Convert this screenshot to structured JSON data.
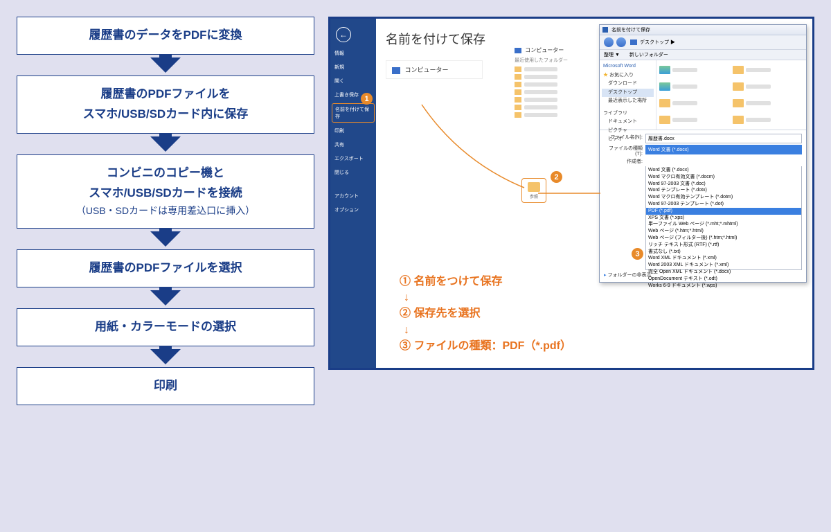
{
  "steps": [
    {
      "main": "履歴書のデータをPDFに変換",
      "sub": ""
    },
    {
      "main": "履歴書のPDFファイルを\nスマホ/USB/SDカード内に保存",
      "sub": ""
    },
    {
      "main": "コンビニのコピー機と\nスマホ/USB/SDカードを接続",
      "sub": "（USB・SDカードは専用差込口に挿入）"
    },
    {
      "main": "履歴書のPDFファイルを選択",
      "sub": ""
    },
    {
      "main": "用紙・カラーモードの選択",
      "sub": ""
    },
    {
      "main": "印刷",
      "sub": ""
    }
  ],
  "word": {
    "menu": [
      "情報",
      "新規",
      "開く",
      "上書き保存",
      "名前を付けて保存",
      "印刷",
      "共有",
      "エクスポート",
      "閉じる",
      "アカウント",
      "オプション"
    ],
    "hl_index": 4,
    "title": "名前を付けて保存",
    "computer_row": "コンピューター",
    "right_header": "コンピューター",
    "right_sub": "最近使用したフォルダー",
    "browse": "参照"
  },
  "dialog": {
    "titlebar": "名前を付けて保存",
    "breadcrumb": "デスクトップ ▶",
    "toolbar": "整理 ▼　　新しいフォルダー",
    "tree": [
      "Microsoft Word",
      "★ お気に入り",
      "　ダウンロード",
      "　デスクトップ",
      "　最近表示した場所",
      "ライブラリ",
      "　ドキュメント",
      "　ピクチャ",
      "　ビデオ"
    ],
    "tree_word_idx": 0,
    "tree_fav_idx": 1,
    "tree_sel_idx": 3,
    "filename_label": "ファイル名(N):",
    "filename_value": "履歴書.docx",
    "filetype_label": "ファイルの種類(T):",
    "filetype_value": "Word 文書 (*.docx)",
    "author_label": "作成者:",
    "folder_label": "フォルダーの非表示",
    "options": [
      "Word 文書 (*.docx)",
      "Word マクロ有効文書 (*.docm)",
      "Word 97-2003 文書 (*.doc)",
      "Word テンプレート (*.dotx)",
      "Word マクロ有効テンプレート (*.dotm)",
      "Word 97-2003 テンプレート (*.dot)",
      "PDF (*.pdf)",
      "XPS 文書 (*.xps)",
      "単一ファイル Web ページ (*.mht;*.mhtml)",
      "Web ページ (*.htm;*.html)",
      "Web ページ (フィルター後) (*.htm;*.html)",
      "リッチ テキスト形式 (RTF) (*.rtf)",
      "書式なし (*.txt)",
      "Word XML ドキュメント (*.xml)",
      "Word 2003 XML ドキュメント (*.xml)",
      "完全 Open XML ドキュメント (*.docx)",
      "OpenDocument テキスト (*.odt)",
      "Works 6-9 ドキュメント (*.wps)"
    ],
    "option_hl_idx": 6
  },
  "instructions": [
    "① 名前をつけて保存",
    "② 保存先を選択",
    "③ ファイルの種類：PDF（*.pdf）"
  ],
  "down_arrow": "↓"
}
